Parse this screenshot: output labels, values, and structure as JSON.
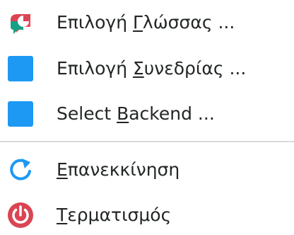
{
  "menu": {
    "items": [
      {
        "pre": "Επιλογή ",
        "mnemonic": "Γ",
        "post": "λώσσας ...",
        "icon": "language-flag-icon"
      },
      {
        "pre": "Επιλογή ",
        "mnemonic": "Σ",
        "post": "υνεδρίας ...",
        "icon": "blue-square-icon"
      },
      {
        "pre": "Select ",
        "mnemonic": "B",
        "post": "ackend ...",
        "icon": "blue-square-icon"
      },
      {
        "pre": "",
        "mnemonic": "Ε",
        "post": "πανεκκίνηση",
        "icon": "restart-icon"
      },
      {
        "pre": "",
        "mnemonic": "Τ",
        "post": "ερματισμός",
        "icon": "shutdown-icon"
      }
    ],
    "colors": {
      "text": "#232627",
      "accent_blue": "#1d99f3",
      "red": "#da4453",
      "teal": "#16a085",
      "separator": "#d9dadb"
    }
  }
}
